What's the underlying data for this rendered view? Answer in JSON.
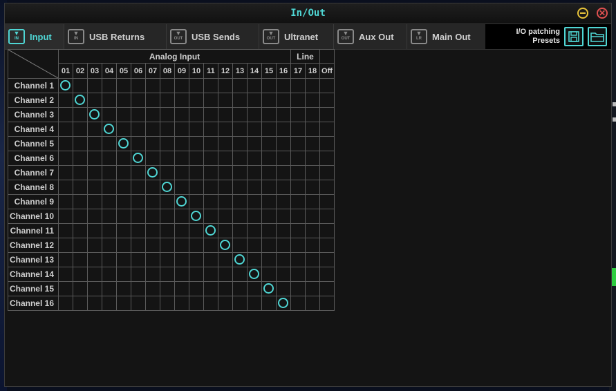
{
  "window": {
    "title": "In/Out",
    "accent": "#4fd6d4"
  },
  "tabs": [
    {
      "label": "Input",
      "icon": "input-icon",
      "icon_text": "IN",
      "active": true
    },
    {
      "label": "USB Returns",
      "icon": "usb-returns-icon",
      "icon_text": "IN",
      "active": false
    },
    {
      "label": "USB Sends",
      "icon": "usb-sends-icon",
      "icon_text": "OUT",
      "active": false
    },
    {
      "label": "Ultranet",
      "icon": "ultranet-icon",
      "icon_text": "OUT",
      "active": false
    },
    {
      "label": "Aux Out",
      "icon": "aux-out-icon",
      "icon_text": "OUT",
      "active": false
    },
    {
      "label": "Main Out",
      "icon": "main-out-icon",
      "icon_text": "LR",
      "active": false
    }
  ],
  "presets": {
    "label_line1": "I/O patching",
    "label_line2": "Presets",
    "save_icon": "save-icon",
    "folder_icon": "folder-icon"
  },
  "matrix": {
    "groups": [
      {
        "label": "Analog Input",
        "span": 16
      },
      {
        "label": "Line",
        "span": 2
      },
      {
        "label": "",
        "span": 1
      }
    ],
    "columns": [
      "01",
      "02",
      "03",
      "04",
      "05",
      "06",
      "07",
      "08",
      "09",
      "10",
      "11",
      "12",
      "13",
      "14",
      "15",
      "16",
      "17",
      "18",
      "Off"
    ],
    "rows": [
      "Channel 1",
      "Channel 2",
      "Channel 3",
      "Channel 4",
      "Channel 5",
      "Channel 6",
      "Channel 7",
      "Channel 8",
      "Channel 9",
      "Channel 10",
      "Channel 11",
      "Channel 12",
      "Channel 13",
      "Channel 14",
      "Channel 15",
      "Channel 16"
    ],
    "patch": [
      0,
      1,
      2,
      3,
      4,
      5,
      6,
      7,
      8,
      9,
      10,
      11,
      12,
      13,
      14,
      15
    ]
  }
}
